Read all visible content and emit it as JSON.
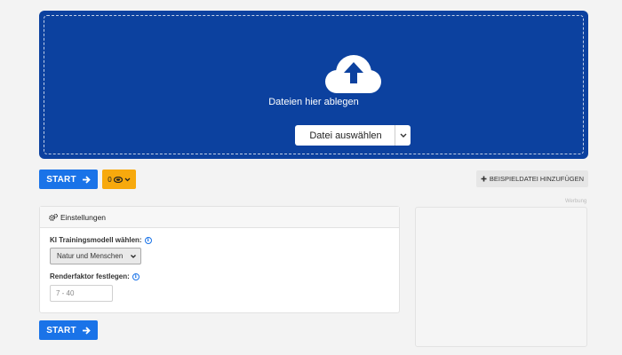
{
  "dropzone": {
    "icon": "cloud-upload-icon",
    "label": "Dateien hier ablegen",
    "file_button": "Datei auswählen",
    "bg_color": "#0c419f"
  },
  "toolbar": {
    "start_label": "START",
    "credits_value": "0",
    "add_sample_label": "BEISPIELDATEI HINZUFÜGEN"
  },
  "settings": {
    "title": "Einstellungen",
    "model_label": "KI Trainingsmodell wählen:",
    "model_value": "Natur und Menschen",
    "factor_label": "Renderfaktor festlegen:",
    "factor_placeholder": "7 - 40"
  },
  "ad": {
    "label": "Werbung"
  },
  "colors": {
    "primary": "#1a73e8",
    "credits": "#f7a90d"
  }
}
